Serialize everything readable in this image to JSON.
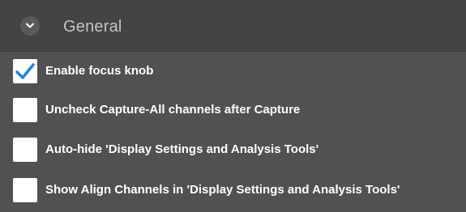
{
  "panel": {
    "section_title": "General",
    "toggle_icon": "chevron-down-icon",
    "options": [
      {
        "label": "Enable focus knob",
        "checked": true
      },
      {
        "label": "Uncheck Capture-All channels after Capture",
        "checked": false
      },
      {
        "label": "Auto-hide 'Display Settings and Analysis Tools'",
        "checked": false
      },
      {
        "label": "Show Align Channels in 'Display Settings and Analysis Tools'",
        "checked": false
      }
    ]
  },
  "colors": {
    "panel_bg": "#515151",
    "header_bg": "#444444",
    "checkmark": "#1f84e0",
    "label_text": "#ffffff",
    "title_text": "#c4c4c4"
  }
}
